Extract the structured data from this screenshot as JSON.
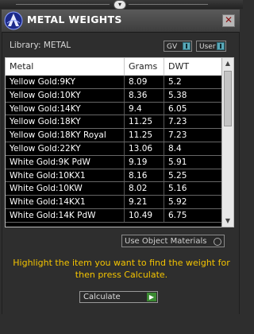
{
  "window": {
    "title": "METAL WEIGHTS"
  },
  "library": {
    "label": "Library: METAL"
  },
  "toggles": [
    {
      "label": "GV"
    },
    {
      "label": "User"
    }
  ],
  "table": {
    "columns": [
      "Metal",
      "Grams",
      "DWT"
    ],
    "rows": [
      [
        "Yellow Gold:9KY",
        "8.09",
        "5.2"
      ],
      [
        "Yellow Gold:10KY",
        "8.36",
        "5.38"
      ],
      [
        "Yellow Gold:14KY",
        "9.4",
        "6.05"
      ],
      [
        "Yellow Gold:18KY",
        "11.25",
        "7.23"
      ],
      [
        "Yellow Gold:18KY Royal",
        "11.25",
        "7.23"
      ],
      [
        "Yellow Gold:22KY",
        "13.06",
        "8.4"
      ],
      [
        "White Gold:9K PdW",
        "9.19",
        "5.91"
      ],
      [
        "White Gold:10KX1",
        "8.16",
        "5.25"
      ],
      [
        "White Gold:10KW",
        "8.02",
        "5.16"
      ],
      [
        "White Gold:14KX1",
        "9.21",
        "5.92"
      ],
      [
        "White Gold:14K PdW",
        "10.49",
        "6.75"
      ]
    ]
  },
  "use_object_materials": {
    "label": "Use Object Materials"
  },
  "hint": "Highlight the item you want to find the weight for then press Calculate.",
  "calculate": {
    "label": "Calculate"
  },
  "colors": {
    "hint": "#f4c400",
    "toggle_indicator": "#5aa8b8",
    "go_button": "#3b8a32"
  }
}
